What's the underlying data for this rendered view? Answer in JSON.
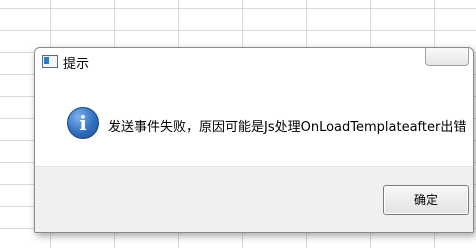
{
  "dialog": {
    "title": "提示",
    "message": "发送事件失败，原因可能是Js处理OnLoadTemplateafter出错",
    "ok_label": "确定",
    "icon": "info-icon",
    "close_icon": "close-icon"
  }
}
